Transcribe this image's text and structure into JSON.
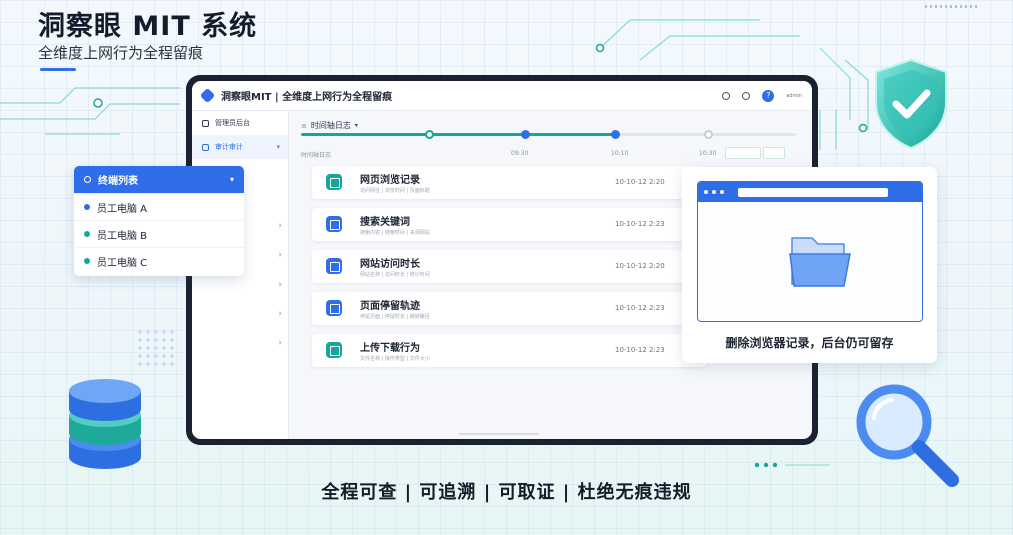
{
  "hero": {
    "title": "洞察眼 MIT 系统",
    "subtitle": "全维度上网行为全程留痕"
  },
  "app": {
    "title": "洞察眼MIT | 全维度上网行为全程留痕",
    "user": "admin"
  },
  "sidebar": {
    "items": [
      {
        "label": "管理员后台"
      },
      {
        "label": "审计审计"
      }
    ]
  },
  "timeline": {
    "tab_label": "时间轴日志",
    "row_label": "时间轴日志",
    "marks": [
      "10:10",
      "09:30",
      "10:30",
      "10:30"
    ],
    "progress": 0.64,
    "buttons": [
      "",
      ""
    ]
  },
  "records": [
    {
      "name": "网页浏览记录",
      "desc": "访问网址 | 浏览时间 | 页面标题",
      "time": "10-10-12 2:20",
      "icon": "cube-icon",
      "color": "#17a79a"
    },
    {
      "name": "搜索关键词",
      "desc": "搜索内容 | 搜索时间 | 来源网站",
      "time": "10-10-12 2:23",
      "icon": "list-icon",
      "color": "#2f6ee8"
    },
    {
      "name": "网站访问时长",
      "desc": "网站名称 | 访问时长 | 统计时间",
      "time": "10-10-12 2:20",
      "icon": "cube-icon",
      "color": "#2f6ee8"
    },
    {
      "name": "页面停留轨迹",
      "desc": "停留页面 | 停留时长 | 跳转路径",
      "time": "10-10-12 2:23",
      "icon": "doc-icon",
      "color": "#2f6ee8"
    },
    {
      "name": "上传下载行为",
      "desc": "文件名称 | 操作类型 | 文件大小",
      "time": "10-10-12 2:23",
      "icon": "clipboard-icon",
      "color": "#17a79a"
    }
  ],
  "terminal_list": {
    "title": "终端列表",
    "items": [
      {
        "label": "员工电脑 A",
        "dot": "#2f6ee8"
      },
      {
        "label": "员工电脑 B",
        "dot": "#17a79a"
      },
      {
        "label": "员工电脑 C",
        "dot": "#17a79a"
      }
    ]
  },
  "browser_card": {
    "url_text": "",
    "caption": "删除浏览器记录，后台仍可留存"
  },
  "slogan": "全程可查 | 可追溯 | 可取证 | 杜绝无痕违规",
  "colors": {
    "brand": "#2f6ee8",
    "teal": "#17a79a"
  }
}
